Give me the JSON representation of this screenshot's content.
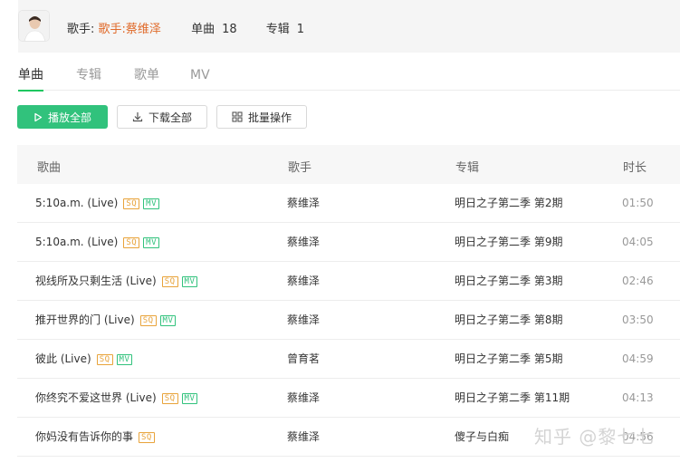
{
  "artist": {
    "singer_label": "歌手:",
    "singer_name": "歌手:蔡维泽",
    "single_label": "单曲",
    "single_count": "18",
    "album_label": "专辑",
    "album_count": "1"
  },
  "tabs": [
    "单曲",
    "专辑",
    "歌单",
    "MV"
  ],
  "actions": {
    "play_all": "播放全部",
    "download_all": "下载全部",
    "batch": "批量操作"
  },
  "table": {
    "headers": {
      "song": "歌曲",
      "singer": "歌手",
      "album": "专辑",
      "duration": "时长"
    },
    "rows": [
      {
        "title": "5:10a.m. (Live)",
        "sq": "SQ",
        "mv": "MV",
        "singer": "蔡维泽",
        "album": "明日之子第二季 第2期",
        "duration": "01:50"
      },
      {
        "title": "5:10a.m. (Live)",
        "sq": "SQ",
        "mv": "MV",
        "singer": "蔡维泽",
        "album": "明日之子第二季 第9期",
        "duration": "04:05"
      },
      {
        "title": "视线所及只剩生活 (Live)",
        "sq": "SQ",
        "mv": "MV",
        "singer": "蔡维泽",
        "album": "明日之子第二季 第3期",
        "duration": "02:46"
      },
      {
        "title": "推开世界的门 (Live)",
        "sq": "SQ",
        "mv": "MV",
        "singer": "蔡维泽",
        "album": "明日之子第二季 第8期",
        "duration": "03:50"
      },
      {
        "title": "彼此 (Live)",
        "sq": "SQ",
        "mv": "MV",
        "singer": "曾育茗",
        "album": "明日之子第二季 第5期",
        "duration": "04:59"
      },
      {
        "title": "你终究不爱这世界 (Live)",
        "sq": "SQ",
        "mv": "MV",
        "singer": "蔡维泽",
        "album": "明日之子第二季 第11期",
        "duration": "04:13"
      },
      {
        "title": "你妈没有告诉你的事",
        "sq": "SQ",
        "mv": null,
        "singer": "蔡维泽",
        "album": "傻子与白痴",
        "duration": "04:56"
      }
    ]
  },
  "watermark": "知乎 @黎七七"
}
